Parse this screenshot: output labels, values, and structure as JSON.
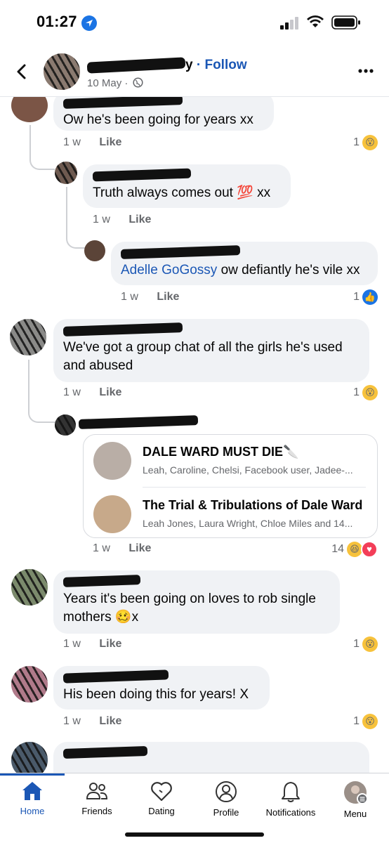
{
  "status_bar": {
    "time": "01:27"
  },
  "header": {
    "follow_label": "· Follow",
    "name_suffix": "y",
    "date": "10 May ·"
  },
  "comments": [
    {
      "text": "Ow he's been going for years xx",
      "time": "1 w",
      "like": "Like",
      "reaction_count": "1"
    },
    {
      "text": "Truth always comes out 💯 xx",
      "time": "1 w",
      "like": "Like"
    },
    {
      "mention": "Adelle GoGossy",
      "text": "ow defiantly he's vile xx",
      "time": "1 w",
      "like": "Like",
      "reaction_count": "1"
    },
    {
      "text": "We've got a group chat of all the girls he's used and abused",
      "time": "1 w",
      "like": "Like",
      "reaction_count": "1"
    },
    {
      "time": "1 w",
      "like": "Like",
      "reaction_count": "14"
    },
    {
      "text": "Years it's been going on loves to rob single mothers 🥴x",
      "time": "1 w",
      "like": "Like",
      "reaction_count": "1"
    },
    {
      "text": "His been doing this for years! X",
      "time": "1 w",
      "like": "Like",
      "reaction_count": "1"
    }
  ],
  "group_chats": [
    {
      "title": "DALE WARD MUST DIE🔪",
      "members": "Leah, Caroline, Chelsi, Facebook user, Jadee-..."
    },
    {
      "title": "The Trial & Tribulations of Dale Ward",
      "members": "Leah Jones, Laura Wright, Chloe Miles and 14..."
    }
  ],
  "tabbar": {
    "tabs": [
      {
        "label": "Home",
        "icon": "home-icon",
        "active": true
      },
      {
        "label": "Friends",
        "icon": "friends-icon"
      },
      {
        "label": "Dating",
        "icon": "dating-icon"
      },
      {
        "label": "Profile",
        "icon": "profile-icon"
      },
      {
        "label": "Notifications",
        "icon": "bell-icon"
      },
      {
        "label": "Menu",
        "icon": "menu-avatar-icon"
      }
    ]
  },
  "colors": {
    "accent": "#1b57b5",
    "bubble": "#f0f2f5",
    "meta": "#65676b"
  }
}
